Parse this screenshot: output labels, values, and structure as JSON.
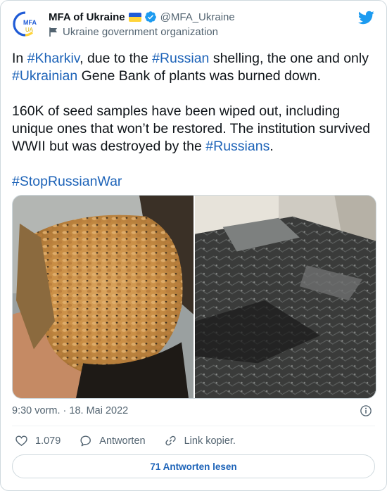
{
  "author": {
    "avatar_text_top": "MFA",
    "avatar_text_bottom": "UA",
    "display_name": "MFA of Ukraine",
    "handle": "@MFA_Ukraine",
    "affiliation": "Ukraine government organization"
  },
  "tweet": {
    "p1_pre": "In ",
    "p1_tag1": "#Kharkiv",
    "p1_mid1": ", due to the ",
    "p1_tag2": "#Russian",
    "p1_mid2": " shelling, the one and only ",
    "p1_tag3": "#Ukrainian",
    "p1_post": " Gene Bank of plants was burned down.",
    "p2_pre": "160K of seed samples have been wiped out, including unique ones that won’t be restored. The institution survived WWII but was destroyed by the ",
    "p2_tag": "#Russians",
    "p2_post": ".",
    "p3_tag": "#StopRussianWar"
  },
  "meta": {
    "timestamp": "9:30 vorm. · 18. Mai 2022"
  },
  "actions": {
    "likes": "1.079",
    "reply_label": "Antworten",
    "copy_link_label": "Link kopier."
  },
  "read_replies_label": "71 Antworten lesen",
  "icons": {
    "verified": "verified-badge-icon",
    "twitter": "twitter-bird-icon",
    "flag": "ukraine-flag-icon",
    "info": "info-icon",
    "like": "heart-icon",
    "reply": "comment-icon",
    "link": "link-icon"
  },
  "colors": {
    "hashtag": "#1d63b8",
    "twitter_blue": "#1d9bf0",
    "flag_blue": "#1f5bd6",
    "flag_yellow": "#ffd43a"
  }
}
